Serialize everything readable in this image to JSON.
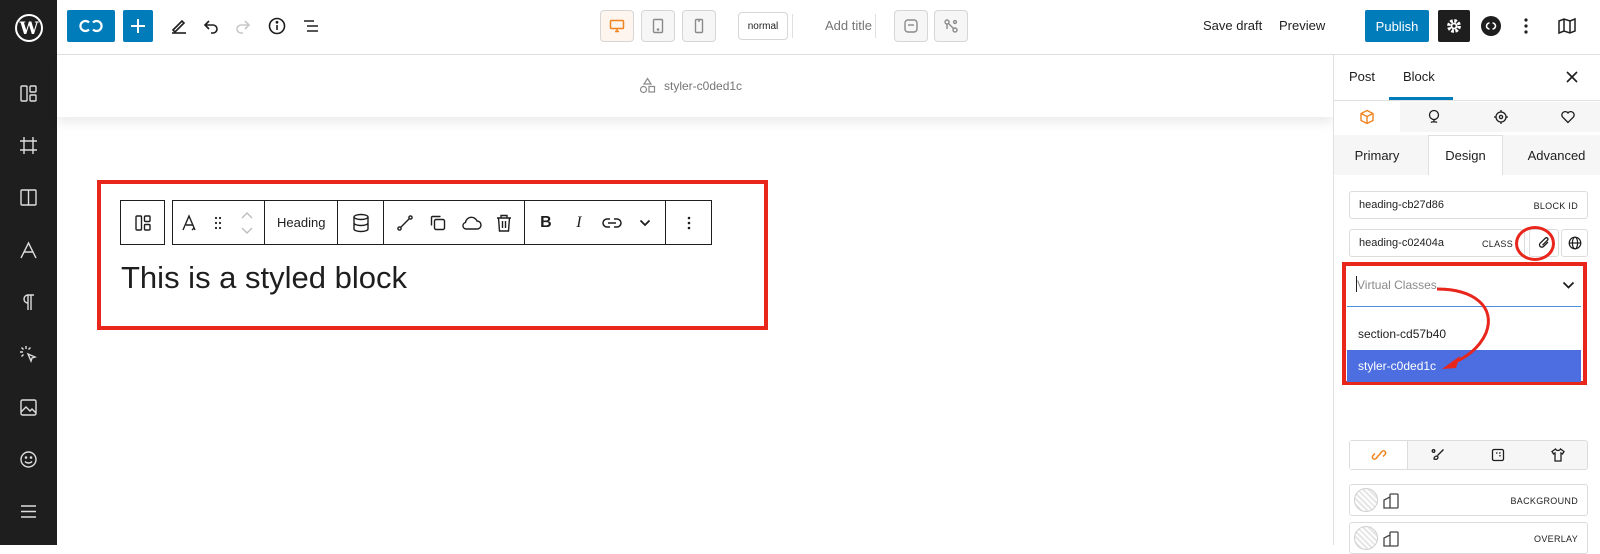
{
  "adminbar": {
    "logo": "wordpress-logo",
    "icons": [
      "layout-icon",
      "frame-icon",
      "columns-icon",
      "typography-icon",
      "paragraph-icon",
      "interaction-icon",
      "image-icon",
      "smiley-icon",
      "menu-icon"
    ]
  },
  "topbar": {
    "mode": "normal",
    "add_title": "Add title",
    "save_draft": "Save draft",
    "preview": "Preview",
    "publish": "Publish"
  },
  "canvas": {
    "styler_label": "styler-c0ded1c",
    "block_toolbar": {
      "heading_label": "Heading"
    },
    "block_text": "This is a styled block"
  },
  "panel": {
    "tabs": [
      "Post",
      "Block"
    ],
    "active_tab": "Block",
    "subtabs": [
      "Primary",
      "Design",
      "Advanced"
    ],
    "active_subtab": "Design",
    "block_id": {
      "value": "heading-cb27d86",
      "tag": "BLOCK ID"
    },
    "class": {
      "value": "heading-c02404a",
      "tag": "CLASS"
    },
    "virtual_classes": {
      "placeholder": "Virtual Classes...",
      "options": [
        "section-cd57b40",
        "styler-c0ded1c"
      ],
      "selected": "styler-c0ded1c"
    },
    "layers": [
      "BACKGROUND",
      "OVERLAY"
    ]
  },
  "colors": {
    "accent": "#007cba",
    "annotation_red": "#e8261c",
    "selected_option": "#4c6ee0",
    "active_icon_orange": "#f0831e"
  }
}
